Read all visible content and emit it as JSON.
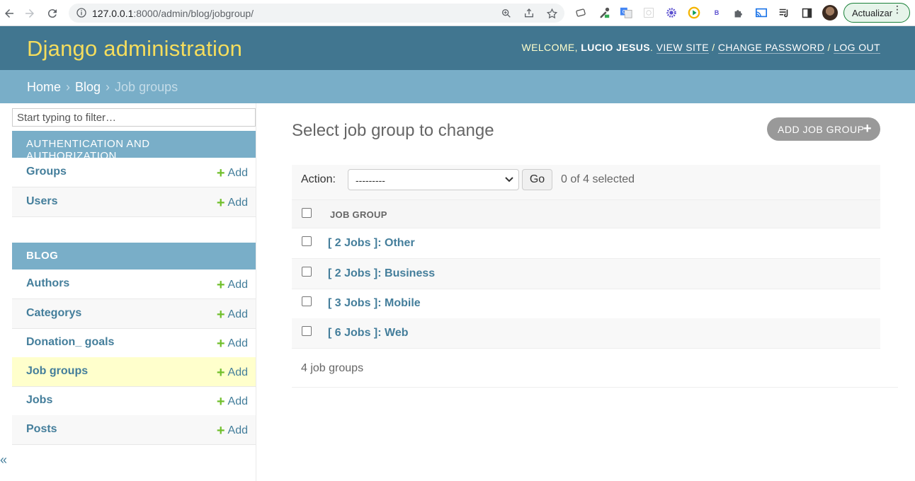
{
  "browser": {
    "url_host": "127.0.0.1",
    "url_path": ":8000/admin/blog/jobgroup/",
    "update_label": "Actualizar"
  },
  "header": {
    "branding": "Django administration",
    "welcome": "WELCOME,",
    "username": "LUCIO JESUS",
    "view_site": "VIEW SITE",
    "change_password": "CHANGE PASSWORD",
    "log_out": "LOG OUT"
  },
  "breadcrumbs": {
    "home": "Home",
    "app": "Blog",
    "current": "Job groups"
  },
  "sidebar": {
    "filter_placeholder": "Start typing to filter…",
    "auth_caption": "AUTHENTICATION AND AUTHORIZATION",
    "auth_models": [
      {
        "name": "Groups",
        "add": "Add"
      },
      {
        "name": "Users",
        "add": "Add"
      }
    ],
    "blog_caption": "BLOG",
    "blog_models": [
      {
        "name": "Authors",
        "add": "Add"
      },
      {
        "name": "Categorys",
        "add": "Add"
      },
      {
        "name": "Donation_ goals",
        "add": "Add"
      },
      {
        "name": "Job groups",
        "add": "Add"
      },
      {
        "name": "Jobs",
        "add": "Add"
      },
      {
        "name": "Posts",
        "add": "Add"
      }
    ],
    "collapse_glyph": "«"
  },
  "content": {
    "title": "Select job group to change",
    "add_button": "ADD JOB GROUP",
    "action_label": "Action:",
    "action_selected": "---------",
    "go": "Go",
    "counter": "0 of 4 selected",
    "column_header": "JOB GROUP",
    "rows": [
      "[ 2 Jobs ]: Other",
      "[ 2 Jobs ]: Business",
      "[ 3 Jobs ]: Mobile",
      "[ 6 Jobs ]: Web"
    ],
    "result_count": "4 job groups"
  },
  "colors": {
    "header_bg": "#417690",
    "breadcrumb_bg": "#79aec8",
    "branding": "#f5dd5d",
    "link": "#447e9b",
    "add_plus": "#70bf2b",
    "current_row": "#ffffcc"
  }
}
